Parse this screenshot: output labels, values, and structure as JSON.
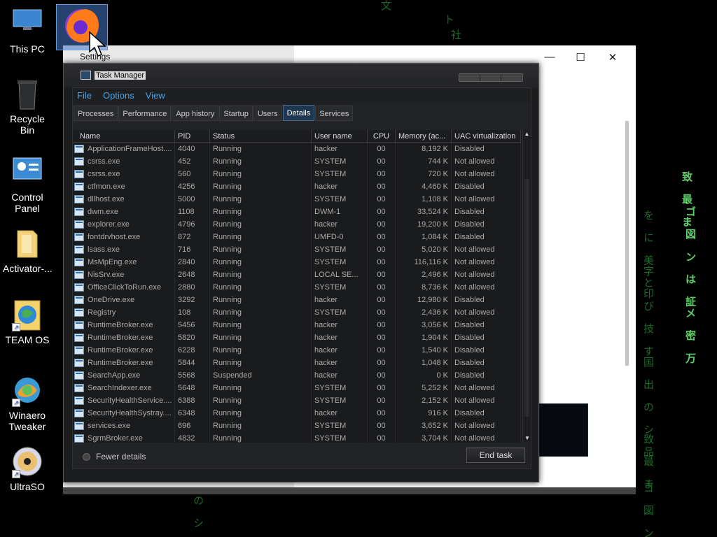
{
  "desktop": {
    "icons": [
      {
        "label": "This PC"
      },
      {
        "label": "Recycle Bin"
      },
      {
        "label": "Control Panel"
      },
      {
        "label": "Activator-..."
      },
      {
        "label": "TEAM OS"
      },
      {
        "label": "Winaero Tweaker"
      },
      {
        "label": "UltraSO"
      }
    ],
    "settings_label": "Settings",
    "matrix_text": [
      "文",
      "ト",
      "社",
      "致 最 ま",
      "ゴ 図 ン は 証",
      "メ 密 万",
      "を に 美 と",
      "字 印",
      "び 技 す",
      "国 出 の シ 品",
      "致 最 ま",
      "ゴ 図 ン",
      "の シ"
    ]
  },
  "settings_window": {
    "minimize": "—",
    "maximize": "☐",
    "close": "✕"
  },
  "task_manager": {
    "title": "Task Manager",
    "menu": [
      "File",
      "Options",
      "View"
    ],
    "tabs": [
      "Processes",
      "Performance",
      "App history",
      "Startup",
      "Users",
      "Details",
      "Services"
    ],
    "active_tab": "Details",
    "columns": [
      "Name",
      "PID",
      "Status",
      "User name",
      "CPU",
      "Memory (ac...",
      "UAC virtualization"
    ],
    "rows": [
      {
        "name": "ApplicationFrameHost....",
        "pid": "4040",
        "status": "Running",
        "user": "hacker",
        "cpu": "00",
        "mem": "8,192 K",
        "uac": "Disabled"
      },
      {
        "name": "csrss.exe",
        "pid": "452",
        "status": "Running",
        "user": "SYSTEM",
        "cpu": "00",
        "mem": "744 K",
        "uac": "Not allowed"
      },
      {
        "name": "csrss.exe",
        "pid": "560",
        "status": "Running",
        "user": "SYSTEM",
        "cpu": "00",
        "mem": "720 K",
        "uac": "Not allowed"
      },
      {
        "name": "ctfmon.exe",
        "pid": "4256",
        "status": "Running",
        "user": "hacker",
        "cpu": "00",
        "mem": "4,460 K",
        "uac": "Disabled"
      },
      {
        "name": "dllhost.exe",
        "pid": "5000",
        "status": "Running",
        "user": "SYSTEM",
        "cpu": "00",
        "mem": "1,108 K",
        "uac": "Not allowed"
      },
      {
        "name": "dwm.exe",
        "pid": "1108",
        "status": "Running",
        "user": "DWM-1",
        "cpu": "00",
        "mem": "33,524 K",
        "uac": "Disabled"
      },
      {
        "name": "explorer.exe",
        "pid": "4796",
        "status": "Running",
        "user": "hacker",
        "cpu": "00",
        "mem": "19,200 K",
        "uac": "Disabled"
      },
      {
        "name": "fontdrvhost.exe",
        "pid": "872",
        "status": "Running",
        "user": "UMFD-0",
        "cpu": "00",
        "mem": "1,084 K",
        "uac": "Disabled"
      },
      {
        "name": "lsass.exe",
        "pid": "716",
        "status": "Running",
        "user": "SYSTEM",
        "cpu": "00",
        "mem": "5,020 K",
        "uac": "Not allowed"
      },
      {
        "name": "MsMpEng.exe",
        "pid": "2840",
        "status": "Running",
        "user": "SYSTEM",
        "cpu": "00",
        "mem": "116,116 K",
        "uac": "Not allowed"
      },
      {
        "name": "NisSrv.exe",
        "pid": "2648",
        "status": "Running",
        "user": "LOCAL SE...",
        "cpu": "00",
        "mem": "2,496 K",
        "uac": "Not allowed"
      },
      {
        "name": "OfficeClickToRun.exe",
        "pid": "2880",
        "status": "Running",
        "user": "SYSTEM",
        "cpu": "00",
        "mem": "8,736 K",
        "uac": "Not allowed"
      },
      {
        "name": "OneDrive.exe",
        "pid": "3292",
        "status": "Running",
        "user": "hacker",
        "cpu": "00",
        "mem": "12,980 K",
        "uac": "Disabled"
      },
      {
        "name": "Registry",
        "pid": "108",
        "status": "Running",
        "user": "SYSTEM",
        "cpu": "00",
        "mem": "2,436 K",
        "uac": "Not allowed"
      },
      {
        "name": "RuntimeBroker.exe",
        "pid": "5456",
        "status": "Running",
        "user": "hacker",
        "cpu": "00",
        "mem": "3,056 K",
        "uac": "Disabled"
      },
      {
        "name": "RuntimeBroker.exe",
        "pid": "5820",
        "status": "Running",
        "user": "hacker",
        "cpu": "00",
        "mem": "1,904 K",
        "uac": "Disabled"
      },
      {
        "name": "RuntimeBroker.exe",
        "pid": "6228",
        "status": "Running",
        "user": "hacker",
        "cpu": "00",
        "mem": "1,540 K",
        "uac": "Disabled"
      },
      {
        "name": "RuntimeBroker.exe",
        "pid": "5844",
        "status": "Running",
        "user": "hacker",
        "cpu": "00",
        "mem": "1,048 K",
        "uac": "Disabled"
      },
      {
        "name": "SearchApp.exe",
        "pid": "5568",
        "status": "Suspended",
        "user": "hacker",
        "cpu": "00",
        "mem": "0 K",
        "uac": "Disabled"
      },
      {
        "name": "SearchIndexer.exe",
        "pid": "5648",
        "status": "Running",
        "user": "SYSTEM",
        "cpu": "00",
        "mem": "5,252 K",
        "uac": "Not allowed"
      },
      {
        "name": "SecurityHealthService....",
        "pid": "6388",
        "status": "Running",
        "user": "SYSTEM",
        "cpu": "00",
        "mem": "2,152 K",
        "uac": "Not allowed"
      },
      {
        "name": "SecurityHealthSystray....",
        "pid": "6348",
        "status": "Running",
        "user": "hacker",
        "cpu": "00",
        "mem": "916 K",
        "uac": "Disabled"
      },
      {
        "name": "services.exe",
        "pid": "696",
        "status": "Running",
        "user": "SYSTEM",
        "cpu": "00",
        "mem": "3,652 K",
        "uac": "Not allowed"
      },
      {
        "name": "SgrmBroker.exe",
        "pid": "4832",
        "status": "Running",
        "user": "SYSTEM",
        "cpu": "00",
        "mem": "3,704 K",
        "uac": "Not allowed"
      }
    ],
    "fewer_details": "Fewer details",
    "end_task": "End task"
  },
  "colors": {
    "menu_blue": "#4aa3e8",
    "matrix_green": "#1a6b2a"
  }
}
